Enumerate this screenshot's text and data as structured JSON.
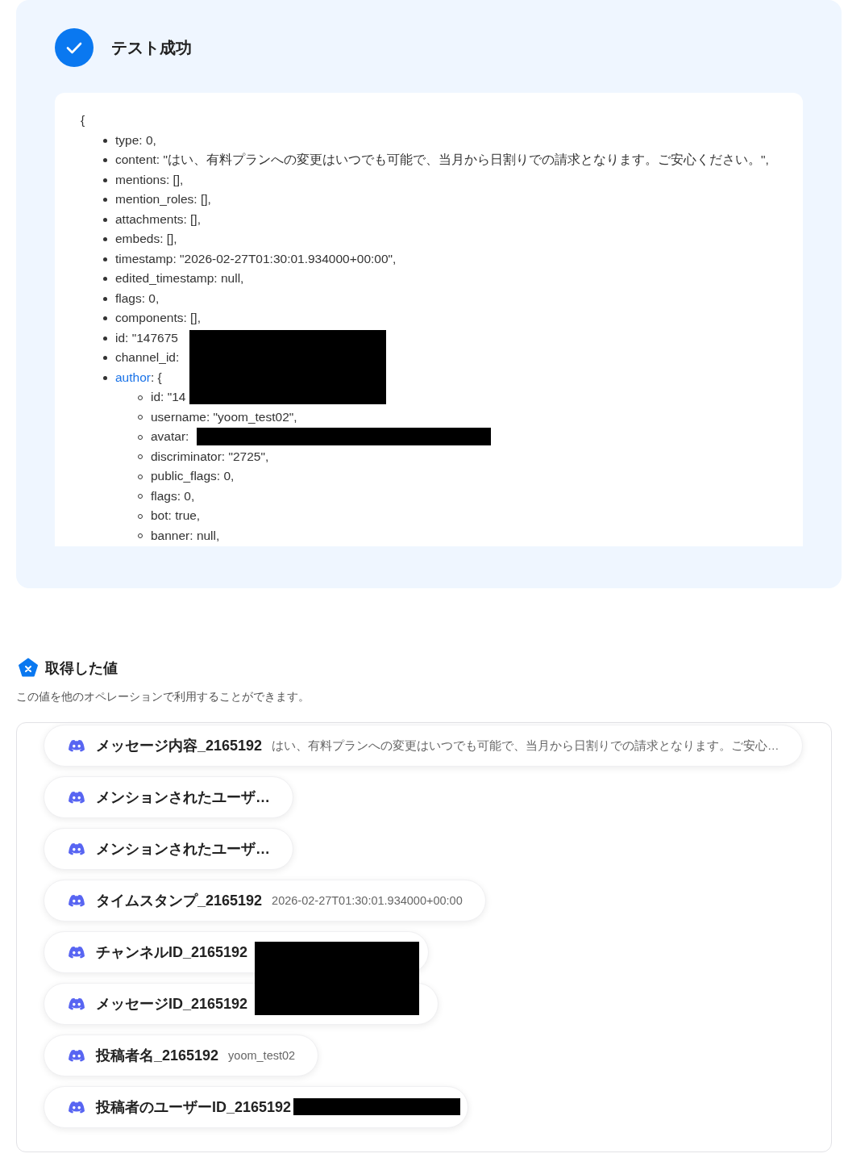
{
  "test_result": {
    "title": "テスト成功",
    "open_brace": "{",
    "lines": [
      {
        "kind": "field",
        "text": "type: 0,",
        "redacted": false
      },
      {
        "kind": "field",
        "text": "content: \"はい、有料プランへの変更はいつでも可能で、当月から日割りでの請求となります。ご安心ください。\",",
        "redacted": false
      },
      {
        "kind": "field",
        "text": "mentions: [],",
        "redacted": false
      },
      {
        "kind": "field",
        "text": "mention_roles: [],",
        "redacted": false
      },
      {
        "kind": "field",
        "text": "attachments: [],",
        "redacted": false
      },
      {
        "kind": "field",
        "text": "embeds: [],",
        "redacted": false
      },
      {
        "kind": "field",
        "text": "timestamp: \"2026-02-27T01:30:01.934000+00:00\",",
        "redacted": false
      },
      {
        "kind": "field",
        "text": "edited_timestamp: null,",
        "redacted": false
      },
      {
        "kind": "field",
        "text": "flags: 0,",
        "redacted": false
      },
      {
        "kind": "field",
        "text": "components: [],",
        "redacted": false
      },
      {
        "kind": "field",
        "text": "id: \"147675",
        "redacted": true
      },
      {
        "kind": "field",
        "text": "channel_id:",
        "redacted": true
      },
      {
        "kind": "object",
        "key": "author",
        "text": ": {",
        "redacted": true,
        "children": [
          {
            "kind": "field",
            "text": "id: \"14",
            "redacted": true
          },
          {
            "kind": "field",
            "text": "username: \"yoom_test02\",",
            "redacted": false
          },
          {
            "kind": "field",
            "text": "avatar:",
            "redacted": true
          },
          {
            "kind": "field",
            "text": "discriminator: \"2725\",",
            "redacted": false
          },
          {
            "kind": "field",
            "text": "public_flags: 0,",
            "redacted": false
          },
          {
            "kind": "field",
            "text": "flags: 0,",
            "redacted": false
          },
          {
            "kind": "field",
            "text": "bot: true,",
            "redacted": false
          },
          {
            "kind": "field",
            "text": "banner: null,",
            "redacted": false
          }
        ]
      }
    ]
  },
  "values": {
    "title": "取得した値",
    "description": "この値を他のオペレーションで利用することができます。",
    "items": [
      {
        "name": "メッセージ内容_2165192",
        "value": "はい、有料プランへの変更はいつでも可能で、当月から日割りでの請求となります。ご安心…",
        "redacted": false
      },
      {
        "name": "メンションされたユーザ…",
        "redacted": false
      },
      {
        "name": "メンションされたユーザ…",
        "redacted": false
      },
      {
        "name": "タイムスタンプ_2165192",
        "value": "2026-02-27T01:30:01.934000+00:00",
        "redacted": false
      },
      {
        "name": "チャンネルID_2165192",
        "redacted": true
      },
      {
        "name": "メッセージID_2165192",
        "redacted": true
      },
      {
        "name": "投稿者名_2165192",
        "value": "yoom_test02",
        "redacted": false
      },
      {
        "name": "投稿者のユーザーID_2165192",
        "redacted": true
      }
    ]
  }
}
